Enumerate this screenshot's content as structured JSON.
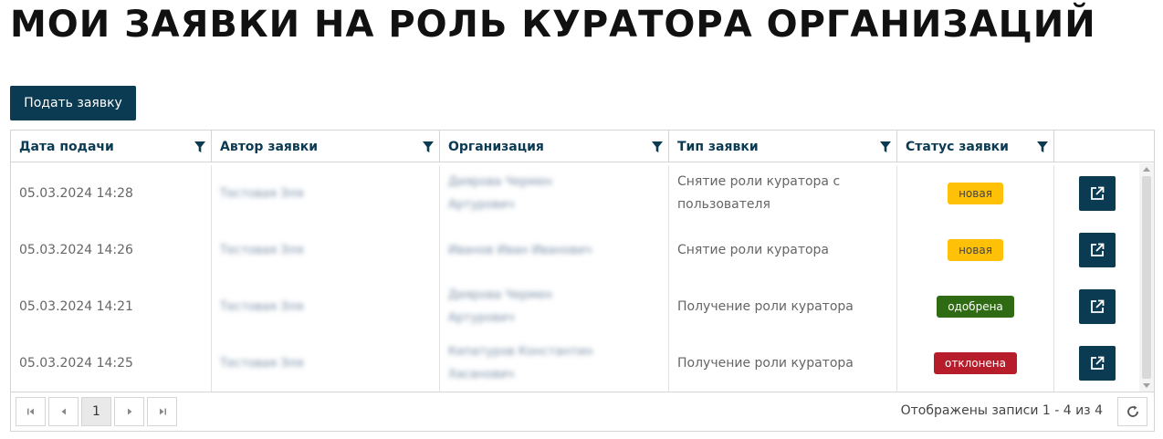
{
  "page": {
    "title": "МОИ ЗАЯВКИ НА РОЛЬ КУРАТОРА ОРГАНИЗАЦИЙ"
  },
  "toolbar": {
    "submit_label": "Подать заявку"
  },
  "table": {
    "columns": [
      {
        "label": "Дата подачи",
        "filter_icon": "filter-icon"
      },
      {
        "label": "Автор заявки",
        "filter_icon": "filter-icon"
      },
      {
        "label": "Организация",
        "filter_icon": "filter-icon"
      },
      {
        "label": "Тип заявки",
        "filter_icon": "filter-icon"
      },
      {
        "label": "Статус заявки",
        "filter_icon": "filter-icon"
      },
      {
        "label": ""
      }
    ],
    "rows": [
      {
        "date": "05.03.2024 14:28",
        "author": "Тестовая Эля",
        "organization": "Диярова Чермен Артурович",
        "type": "Снятие роли куратора с пользователя",
        "status": "новая",
        "status_color": "#ffc107",
        "action_icon": "open-external-icon"
      },
      {
        "date": "05.03.2024 14:26",
        "author": "Тестовая Эля",
        "organization": "Иванов Иван Иванович",
        "type": "Снятие роли куратора",
        "status": "новая",
        "status_color": "#ffc107",
        "action_icon": "open-external-icon"
      },
      {
        "date": "05.03.2024 14:21",
        "author": "Тестовая Эля",
        "organization": "Диярова Чермен Артурович",
        "type": "Получение роли куратора",
        "status": "одобрена",
        "status_color": "#2e6b12",
        "action_icon": "open-external-icon"
      },
      {
        "date": "05.03.2024 14:25",
        "author": "Тестовая Эля",
        "organization": "Кепатуров Константин Хасанович",
        "type": "Получение роли куратора",
        "status": "отклонена",
        "status_color": "#b71c2a",
        "action_icon": "open-external-icon"
      }
    ]
  },
  "pager": {
    "current_page": "1",
    "info": "Отображены записи 1 - 4 из 4",
    "icons": [
      "first-page-icon",
      "prev-page-icon",
      "next-page-icon",
      "last-page-icon",
      "refresh-icon"
    ]
  },
  "colors": {
    "accent": "#0b3a53",
    "status_new": "#ffc107",
    "status_approved": "#2e6b12",
    "status_rejected": "#b71c2a"
  }
}
